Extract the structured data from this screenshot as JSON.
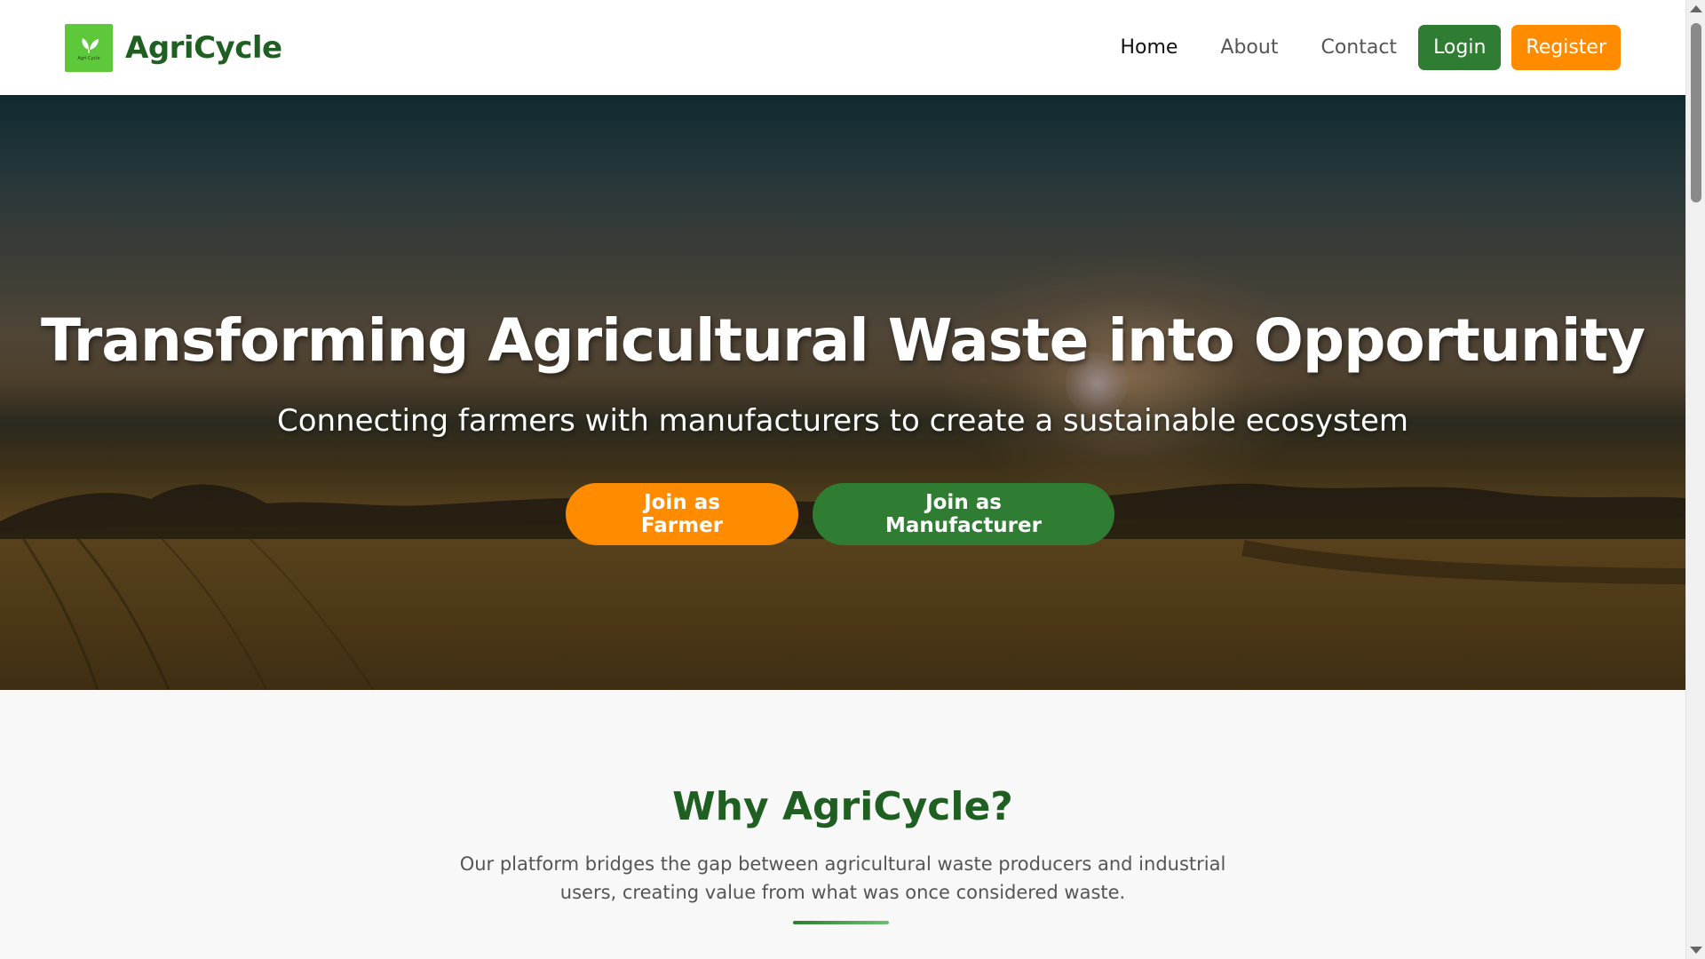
{
  "header": {
    "brand_name": "AgriCycle",
    "logo_text": "Agri Cycle",
    "nav": {
      "home": "Home",
      "about": "About",
      "contact": "Contact"
    },
    "login_label": "Login",
    "register_label": "Register"
  },
  "hero": {
    "title": "Transforming Agricultural Waste into Opportunity",
    "subtitle": "Connecting farmers with manufacturers to create a sustainable ecosystem",
    "farmer_button": "Join as Farmer",
    "manufacturer_button": "Join as Manufacturer"
  },
  "why": {
    "title": "Why AgriCycle?",
    "description": "Our platform bridges the gap between agricultural waste producers and industrial users, creating value from what was once considered waste."
  },
  "colors": {
    "brand_green": "#2e7d32",
    "dark_green": "#1f5f22",
    "accent_orange": "#ff8c00",
    "logo_green": "#5dc93a"
  },
  "icons": {
    "logo": "leaf-icon",
    "scroll_up": "scroll-up-arrow-icon",
    "scroll_down": "scroll-down-arrow-icon"
  }
}
